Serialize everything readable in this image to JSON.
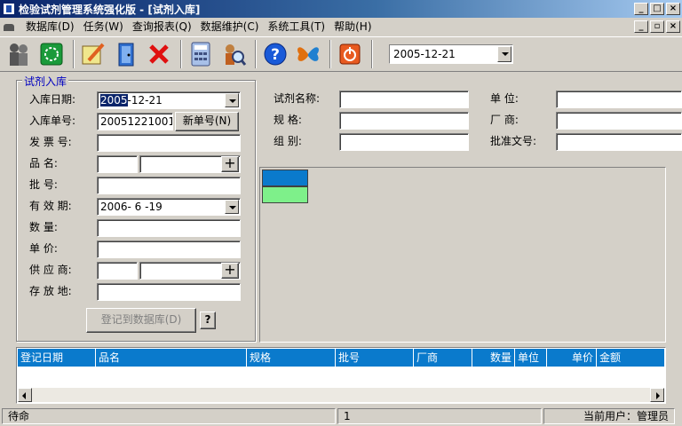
{
  "window": {
    "title": "检验试剂管理系统强化版 - [试剂入库]"
  },
  "menu": [
    "数据库(D)",
    "任务(W)",
    "查询报表(Q)",
    "数据维护(C)",
    "系统工具(T)",
    "帮助(H)"
  ],
  "toolbar": {
    "date": "2005-12-21"
  },
  "form": {
    "group_title": "试剂入库",
    "fields": {
      "entry_date": {
        "label": "入库日期:",
        "value_sel": "2005",
        "value_rest": "-12-21"
      },
      "entry_no": {
        "label": "入库单号:",
        "value": "20051221001",
        "new_no_button": "新单号(N)"
      },
      "invoice_no": {
        "label": "发 票 号:"
      },
      "product_name": {
        "label": "品    名:"
      },
      "batch_no": {
        "label": "批    号:"
      },
      "expiry": {
        "label": "有 效 期:",
        "value": "2006- 6 -19"
      },
      "quantity": {
        "label": "数    量:"
      },
      "unit_price": {
        "label": "单    价:"
      },
      "supplier": {
        "label": "供 应 商:"
      },
      "storage": {
        "label": "存 放 地:"
      }
    },
    "register_button": "登记到数据库(D)",
    "help_button": "?"
  },
  "info": {
    "reagent_name": "试剂名称:",
    "spec": "规    格:",
    "group": "组    别:",
    "unit": "单    位:",
    "maker": "厂    商:",
    "approval": "批准文号:"
  },
  "table": {
    "columns": [
      "登记日期",
      "品名",
      "规格",
      "批号",
      "厂商",
      "数量",
      "单位",
      "单价",
      "金额"
    ]
  },
  "status": {
    "left": "待命",
    "middle": "1",
    "right": "当前用户：管理员"
  },
  "colors": {
    "title_start": "#0a246a",
    "header_blue": "#0a7acc",
    "cell_green": "#7ef08a"
  }
}
